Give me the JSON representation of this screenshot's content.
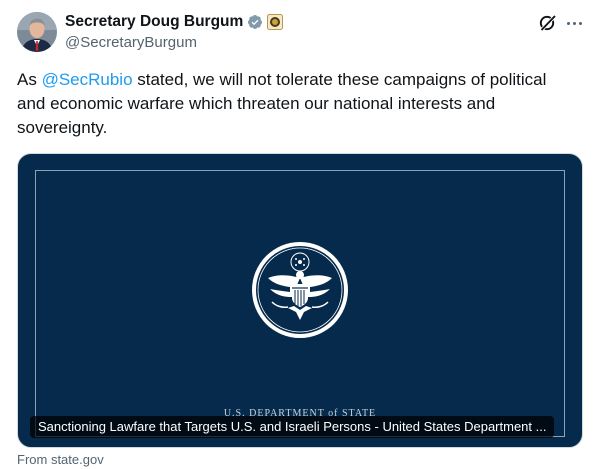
{
  "author": {
    "display_name": "Secretary Doug Burgum",
    "handle": "@SecretaryBurgum",
    "verified_badge_color": "#829aab",
    "affiliation_icon": "department-seal-icon"
  },
  "post": {
    "text_prefix": "As ",
    "mention": "@SecRubio",
    "text_suffix": " stated, we will not tolerate these campaigns of political and economic warfare which threaten our national interests and sovereignty."
  },
  "card": {
    "image_label": "U.S. DEPARTMENT of STATE",
    "title": "Sanctioning Lawfare that Targets U.S. and Israeli Persons - United States Department ...",
    "source": "From state.gov",
    "background_color": "#062a4b"
  },
  "colors": {
    "link": "#1d9bf0",
    "secondary_text": "#536471"
  },
  "icons": {
    "grok": "grok-icon",
    "more": "more-options-icon"
  }
}
